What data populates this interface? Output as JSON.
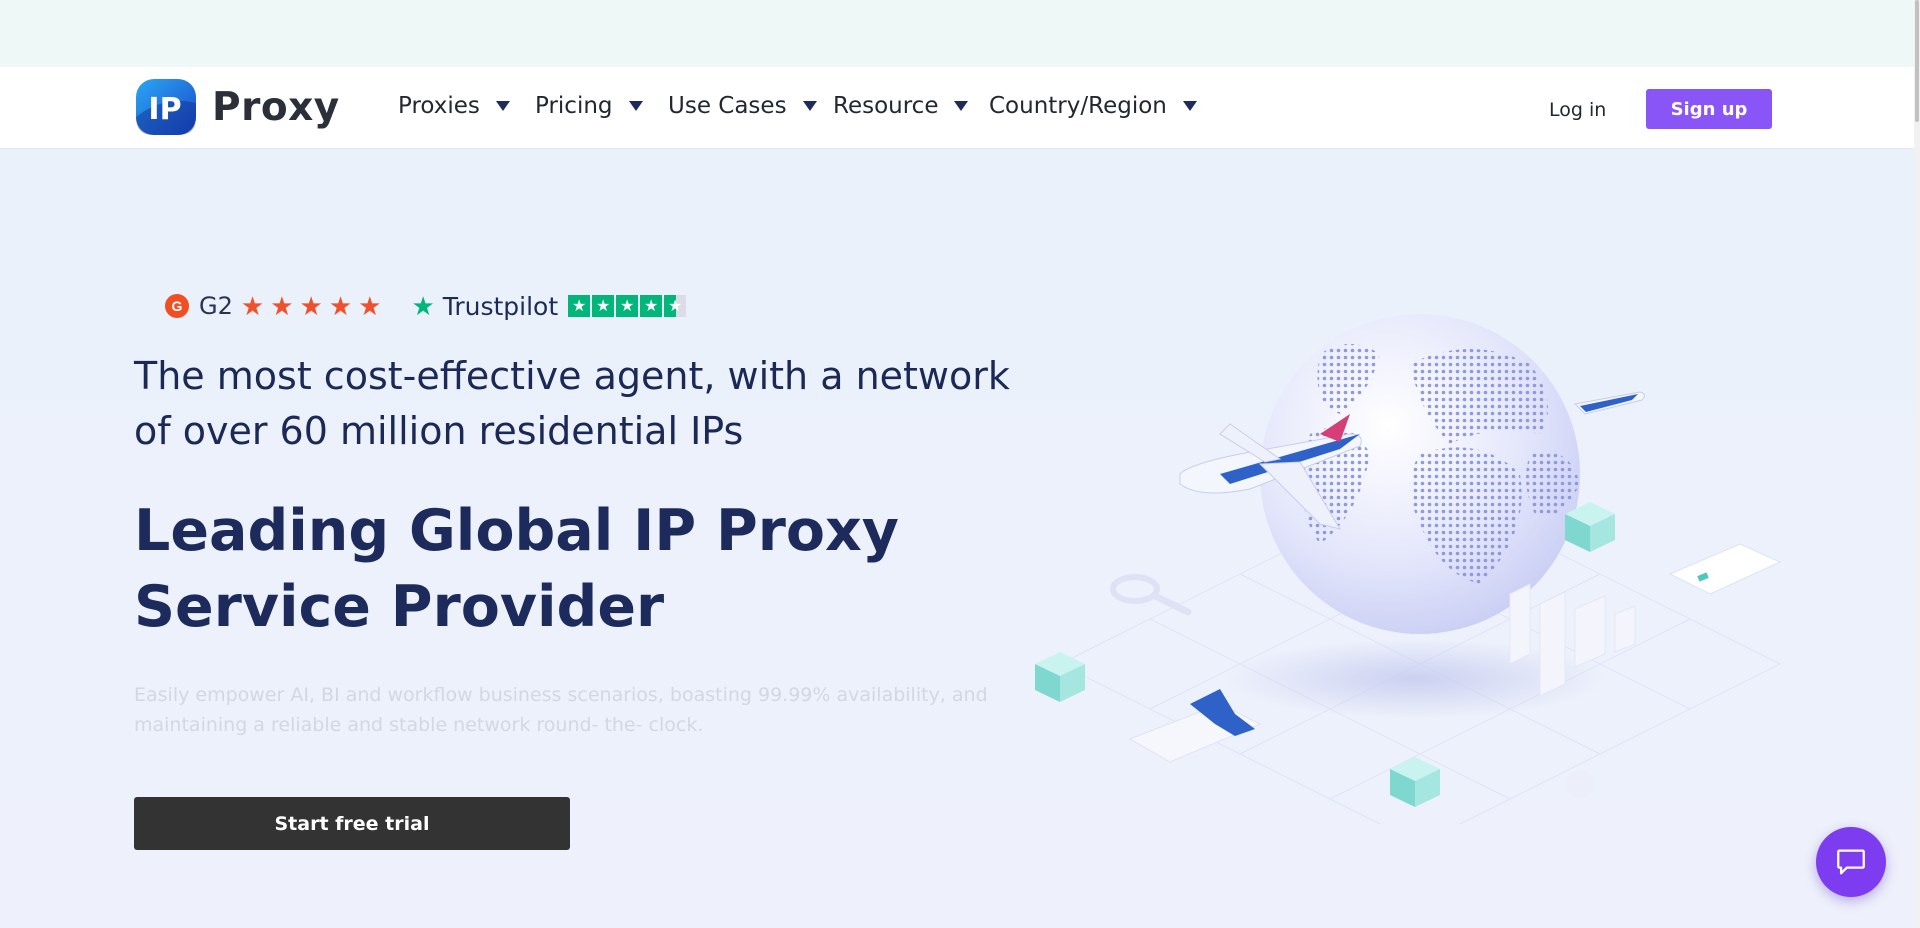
{
  "logo": {
    "mark_text": "IP",
    "brand": "Proxy"
  },
  "nav": {
    "items": [
      {
        "label": "Proxies"
      },
      {
        "label": "Pricing"
      },
      {
        "label": "Use Cases"
      },
      {
        "label": "Resource"
      },
      {
        "label": "Country/Region"
      }
    ],
    "login_label": "Log in",
    "signup_label": "Sign up"
  },
  "hero": {
    "ratings": {
      "g2_icon": "G",
      "g2_label": "G2",
      "g2_stars": 5,
      "trustpilot_label": "Trustpilot",
      "trustpilot_stars": 4.5
    },
    "subtitle": "The most cost-effective agent, with a network of over 60 million residential IPs",
    "headline": "Leading Global IP Proxy Service Provider",
    "description": "Easily empower AI, BI and workflow business scenarios, boasting 99.99% availability, and maintaining a reliable and stable network round- the- clock.",
    "cta_label": "Start free trial",
    "illustration": "globe-with-airplanes"
  },
  "icons": {
    "caret": "caret-down-icon",
    "chat": "chat-bubble-icon",
    "star": "star-icon"
  },
  "colors": {
    "brand_purple": "#8a55f7",
    "headline_navy": "#1c2b5c",
    "g2_red": "#f04e23",
    "trustpilot_green": "#00b67a",
    "cta_dark": "#333333",
    "chat_purple": "#7d3cf0"
  }
}
